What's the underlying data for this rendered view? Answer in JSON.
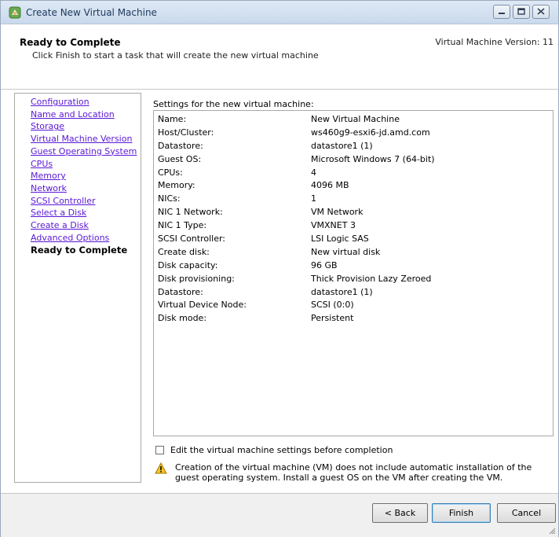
{
  "window": {
    "title": "Create New Virtual Machine",
    "icon": "vsphere-app-icon",
    "controls": [
      "minimize-icon",
      "maximize-icon",
      "close-icon"
    ]
  },
  "header": {
    "title": "Ready to Complete",
    "subtitle": "Click Finish to start a task that will create the new virtual machine",
    "version": "Virtual Machine Version: 11"
  },
  "nav": {
    "items": [
      {
        "label": "Configuration"
      },
      {
        "label": "Name and Location"
      },
      {
        "label": "Storage"
      },
      {
        "label": "Virtual Machine Version"
      },
      {
        "label": "Guest Operating System"
      },
      {
        "label": "CPUs"
      },
      {
        "label": "Memory"
      },
      {
        "label": "Network"
      },
      {
        "label": "SCSI Controller"
      },
      {
        "label": "Select a Disk"
      },
      {
        "label": "Create a Disk"
      },
      {
        "label": "Advanced Options"
      }
    ],
    "current": "Ready to Complete"
  },
  "settings": {
    "label": "Settings for the new virtual machine:",
    "rows": [
      {
        "key": "Name:",
        "value": "New Virtual Machine"
      },
      {
        "key": "Host/Cluster:",
        "value": "ws460g9-esxi6-jd.amd.com"
      },
      {
        "key": "Datastore:",
        "value": "datastore1 (1)"
      },
      {
        "key": "Guest OS:",
        "value": "Microsoft Windows 7 (64-bit)"
      },
      {
        "key": "CPUs:",
        "value": "4"
      },
      {
        "key": "Memory:",
        "value": "4096 MB"
      },
      {
        "key": "NICs:",
        "value": "1"
      },
      {
        "key": "NIC 1 Network:",
        "value": "VM Network"
      },
      {
        "key": "NIC 1 Type:",
        "value": "VMXNET 3"
      },
      {
        "key": "SCSI Controller:",
        "value": "LSI Logic SAS"
      },
      {
        "key": "Create disk:",
        "value": "New virtual disk"
      },
      {
        "key": "Disk capacity:",
        "value": "96 GB"
      },
      {
        "key": "Disk provisioning:",
        "value": "Thick Provision Lazy Zeroed"
      },
      {
        "key": "Datastore:",
        "value": "datastore1 (1)"
      },
      {
        "key": "Virtual Device Node:",
        "value": "SCSI (0:0)"
      },
      {
        "key": "Disk mode:",
        "value": "Persistent"
      }
    ]
  },
  "edit_checkbox": {
    "label": "Edit the virtual machine settings before completion",
    "checked": false
  },
  "warning": {
    "icon": "warning-icon",
    "text": "Creation of the virtual machine (VM) does not include automatic installation of the guest operating system. Install a guest OS on the VM after creating the VM."
  },
  "buttons": {
    "back": "< Back",
    "finish": "Finish",
    "cancel": "Cancel"
  },
  "colors": {
    "link": "#5a17d6",
    "titlebar": "#dfe9f5",
    "footer": "#f0f0f0"
  }
}
